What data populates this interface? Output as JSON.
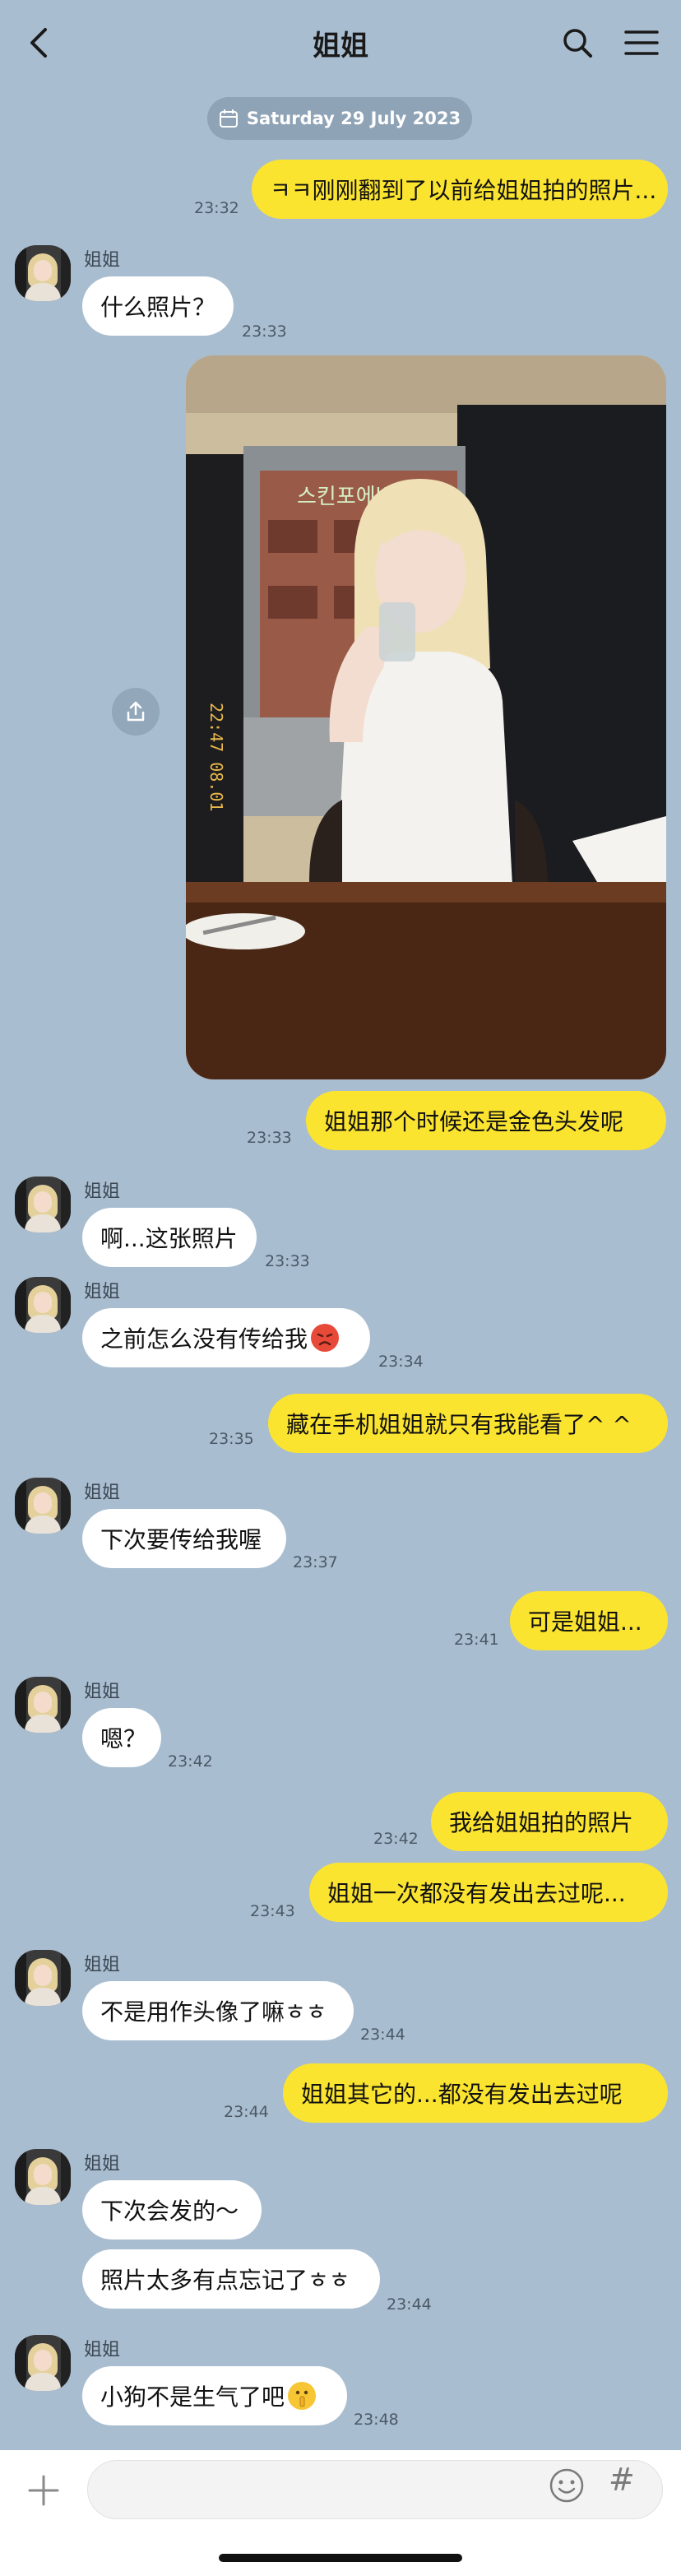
{
  "header": {
    "title": "姐姐"
  },
  "date_label": "Saturday 29 July 2023",
  "sender_name": "姐姐",
  "messages": {
    "m1": {
      "text": "ㅋㅋ刚刚翻到了以前给姐姐拍的照片...",
      "time": "23:32"
    },
    "m2": {
      "text": "什么照片？",
      "time": "23:33"
    },
    "m3": {
      "time": "23:33"
    },
    "m4": {
      "text": "姐姐那个时候还是金色头发呢",
      "time": "23:33"
    },
    "m5": {
      "text": "啊...这张照片",
      "time": "23:33"
    },
    "m6": {
      "text": "之前怎么没有传给我",
      "time": "23:34"
    },
    "m7": {
      "text": "藏在手机姐姐就只有我能看了^ ^",
      "time": "23:35"
    },
    "m8": {
      "text": "下次要传给我喔",
      "time": "23:37"
    },
    "m9": {
      "text": "可是姐姐...",
      "time": "23:41"
    },
    "m10": {
      "text": "嗯？",
      "time": "23:42"
    },
    "m11": {
      "text": "我给姐姐拍的照片",
      "time": "23:42"
    },
    "m12": {
      "text": "姐姐一次都没有发出去过呢...",
      "time": "23:43"
    },
    "m13": {
      "text": "不是用作头像了嘛ㅎㅎ",
      "time": "23:44"
    },
    "m14": {
      "text": "姐姐其它的...都没有发出去过呢",
      "time": "23:44"
    },
    "m15": {
      "text": "下次会发的～"
    },
    "m16": {
      "text": "照片太多有点忘记了ㅎㅎ",
      "time": "23:44"
    },
    "m17": {
      "text": "小狗不是生气了吧",
      "time": "23:48"
    }
  },
  "photo": {
    "sign_text": "스킨포에버",
    "stamp_text": "22:47 08.01"
  },
  "input": {
    "placeholder": ""
  },
  "icons": {
    "back": "chevron-left-icon",
    "search": "search-icon",
    "menu": "menu-icon",
    "calendar": "calendar-icon",
    "share": "share-icon",
    "plus": "plus-icon",
    "emoji": "emoji-icon",
    "hash": "hashtag-icon"
  },
  "colors": {
    "background": "#a9bdd0",
    "my_bubble": "#fbe430",
    "their_bubble": "#ffffff"
  }
}
